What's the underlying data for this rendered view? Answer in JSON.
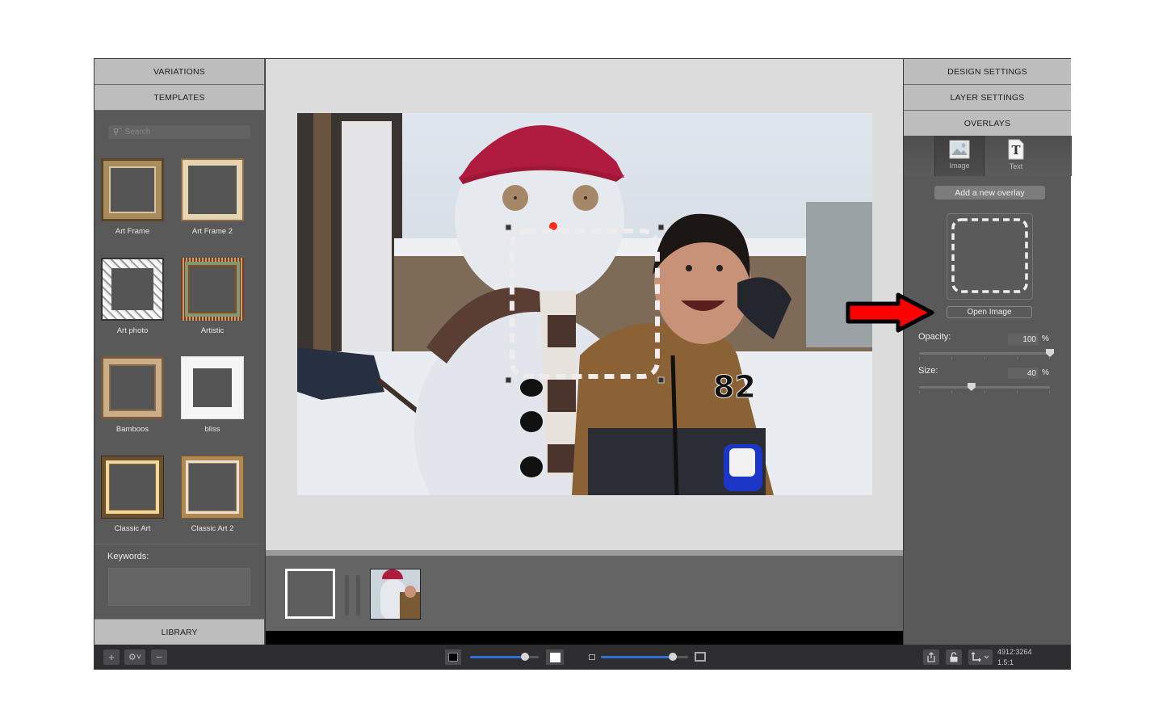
{
  "left_panel": {
    "variations_label": "VARIATIONS",
    "templates_label": "TEMPLATES",
    "search_placeholder": "Search",
    "search_icon": "magnifier-dropdown-icon",
    "templates": [
      {
        "label": "Art Frame",
        "style": "art-frame"
      },
      {
        "label": "Art Frame 2",
        "style": "art-frame-2"
      },
      {
        "label": "Art photo",
        "style": "art-photo"
      },
      {
        "label": "Artistic",
        "style": "artistic"
      },
      {
        "label": "Bamboos",
        "style": "bamboos"
      },
      {
        "label": "bliss",
        "style": "bliss"
      },
      {
        "label": "Classic Art",
        "style": "classic-art"
      },
      {
        "label": "Classic Art 2",
        "style": "classic-art-2"
      }
    ],
    "keywords_label": "Keywords:",
    "keywords_value": "",
    "library_label": "LIBRARY"
  },
  "right_panel": {
    "design_settings_label": "DESIGN SETTINGS",
    "layer_settings_label": "LAYER SETTINGS",
    "overlays_label": "OVERLAYS",
    "overlay_tabs": [
      {
        "label": "Image",
        "icon": "image-icon",
        "active": true
      },
      {
        "label": "Text",
        "icon": "text-icon",
        "active": false
      }
    ],
    "add_overlay_label": "Add a new overlay",
    "open_image_label": "Open Image",
    "opacity": {
      "label": "Opacity:",
      "value": "100",
      "unit": "%",
      "fraction": 1.0
    },
    "size": {
      "label": "Size:",
      "value": "40",
      "unit": "%",
      "fraction": 0.4
    }
  },
  "filmstrip": {
    "items": [
      {
        "name": "frame-template-thumb"
      },
      {
        "name": "snowman-photo-thumb"
      }
    ]
  },
  "bottom_bar": {
    "add_label": "+",
    "gear_label": "⚙˅",
    "remove_label": "−",
    "background_slider_fraction": 0.8,
    "zoom_slider_fraction": 0.82,
    "dimensions": "4912:3264",
    "ratio": "1.5:1"
  },
  "colors": {
    "accent_blue": "#2f6fd6",
    "annotation_arrow": "#ff0000",
    "panel_header": "#bdbdbd",
    "panel_bg": "#595959"
  }
}
